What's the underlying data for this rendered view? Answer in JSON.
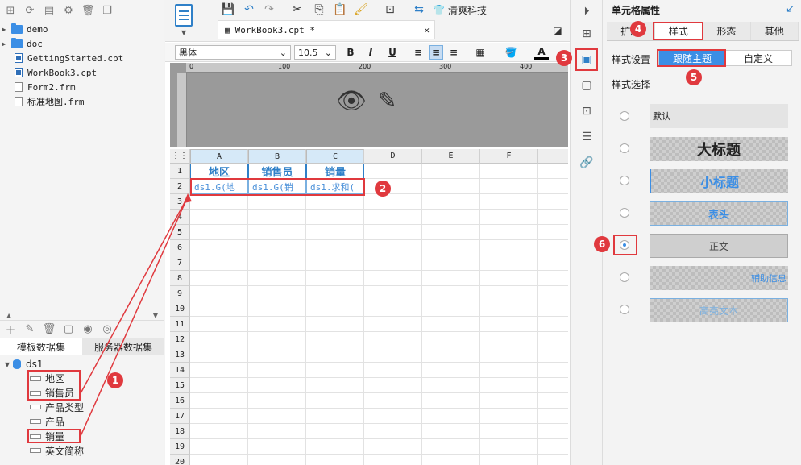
{
  "left": {
    "files": [
      {
        "name": "demo",
        "type": "folder"
      },
      {
        "name": "doc",
        "type": "folder"
      },
      {
        "name": "GettingStarted.cpt",
        "type": "cpt"
      },
      {
        "name": "WorkBook3.cpt",
        "type": "cpt"
      },
      {
        "name": "Form2.frm",
        "type": "frm"
      },
      {
        "name": "标准地图.frm",
        "type": "frm"
      }
    ],
    "tabs": {
      "template": "模板数据集",
      "server": "服务器数据集"
    },
    "dataset": {
      "name": "ds1",
      "fields": [
        "地区",
        "销售员",
        "产品类型",
        "产品",
        "销量",
        "英文简称"
      ]
    }
  },
  "center": {
    "tab_title": "WorkBook3.cpt *",
    "theme_button": "清爽科技",
    "font_name": "黑体",
    "font_size": "10.5",
    "format": {
      "bold": "B",
      "italic": "I",
      "underline": "U",
      "font_color": "A"
    },
    "ruler": {
      "marks": [
        "0",
        "100",
        "200",
        "300",
        "400"
      ]
    },
    "columns": [
      "A",
      "B",
      "C",
      "D",
      "E",
      "F"
    ],
    "rows": [
      "1",
      "2",
      "3",
      "4",
      "5",
      "6",
      "7",
      "8",
      "9",
      "10",
      "11",
      "12",
      "13",
      "14",
      "15",
      "16",
      "17",
      "18",
      "19",
      "20"
    ],
    "cells": {
      "a1": "地区",
      "b1": "销售员",
      "c1": "销量",
      "a2": "ds1.G(地",
      "b2": "ds1.G(销",
      "c2": "ds1.求和("
    }
  },
  "right": {
    "title": "单元格属性",
    "tabs": [
      "扩展",
      "样式",
      "形态",
      "其他"
    ],
    "style_setting_label": "样式设置",
    "segments": [
      "跟随主题",
      "自定义"
    ],
    "style_select_label": "样式选择",
    "styles": [
      {
        "label": "默认"
      },
      {
        "label": "大标题"
      },
      {
        "label": "小标题"
      },
      {
        "label": "表头"
      },
      {
        "label": "正文"
      },
      {
        "label": "辅助信息"
      },
      {
        "label": "高亮文本"
      }
    ]
  },
  "badges": [
    "1",
    "2",
    "3",
    "4",
    "5",
    "6"
  ],
  "colors": {
    "accent": "#3b8ee5",
    "highlight": "#e0393e",
    "header_blue": "#2f80c8"
  }
}
